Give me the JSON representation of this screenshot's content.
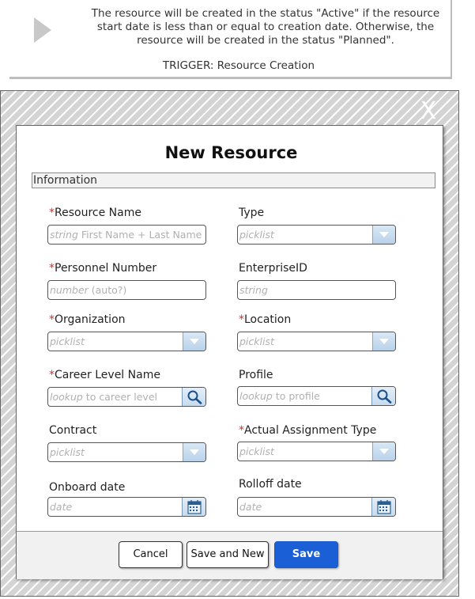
{
  "note": {
    "text": "The resource will be created in the status \"Active\" if the resource start date is less than or equal to creation date. Otherwise, the resource will be created in the status \"Planned\".",
    "trigger": "TRIGGER: Resource Creation"
  },
  "dialog": {
    "close_label": "X",
    "title": "New Resource",
    "section": "Information",
    "required_mark": "*",
    "fields": {
      "resource_name": {
        "label": "Resource Name",
        "ph_italic": "string",
        "ph_rest": " First Name + Last Name",
        "required": true
      },
      "type": {
        "label": "Type",
        "ph_italic": "picklist",
        "ph_rest": "",
        "required": false
      },
      "personnel_number": {
        "label": "Personnel Number",
        "ph_italic": "number",
        "ph_rest": " (auto?)",
        "required": true
      },
      "enterprise_id": {
        "label": "EnterpriseID",
        "ph_italic": "string",
        "ph_rest": "",
        "required": false
      },
      "organization": {
        "label": "Organization",
        "ph_italic": "picklist",
        "ph_rest": "",
        "required": true
      },
      "location": {
        "label": "Location",
        "ph_italic": "picklist",
        "ph_rest": "",
        "required": true
      },
      "career_level": {
        "label": "Career Level Name",
        "ph_italic": "lookup",
        "ph_rest": " to career level",
        "required": true
      },
      "profile": {
        "label": "Profile",
        "ph_italic": "lookup",
        "ph_rest": " to profile",
        "required": false
      },
      "contract": {
        "label": "Contract",
        "ph_italic": "picklist",
        "ph_rest": "",
        "required": false
      },
      "actual_assignment_type": {
        "label": "Actual Assignment Type",
        "ph_italic": "picklist",
        "ph_rest": "",
        "required": true
      },
      "onboard_date": {
        "label": "Onboard date",
        "ph_italic": "date",
        "ph_rest": "",
        "required": false
      },
      "rolloff_date": {
        "label": "Rolloff date",
        "ph_italic": "date",
        "ph_rest": "",
        "required": false
      }
    },
    "buttons": {
      "cancel": "Cancel",
      "save_and_new": "Save and New",
      "save": "Save"
    }
  },
  "colors": {
    "accent": "#1a5fd6",
    "required": "#d93025",
    "picker": "#b9d2ea"
  }
}
